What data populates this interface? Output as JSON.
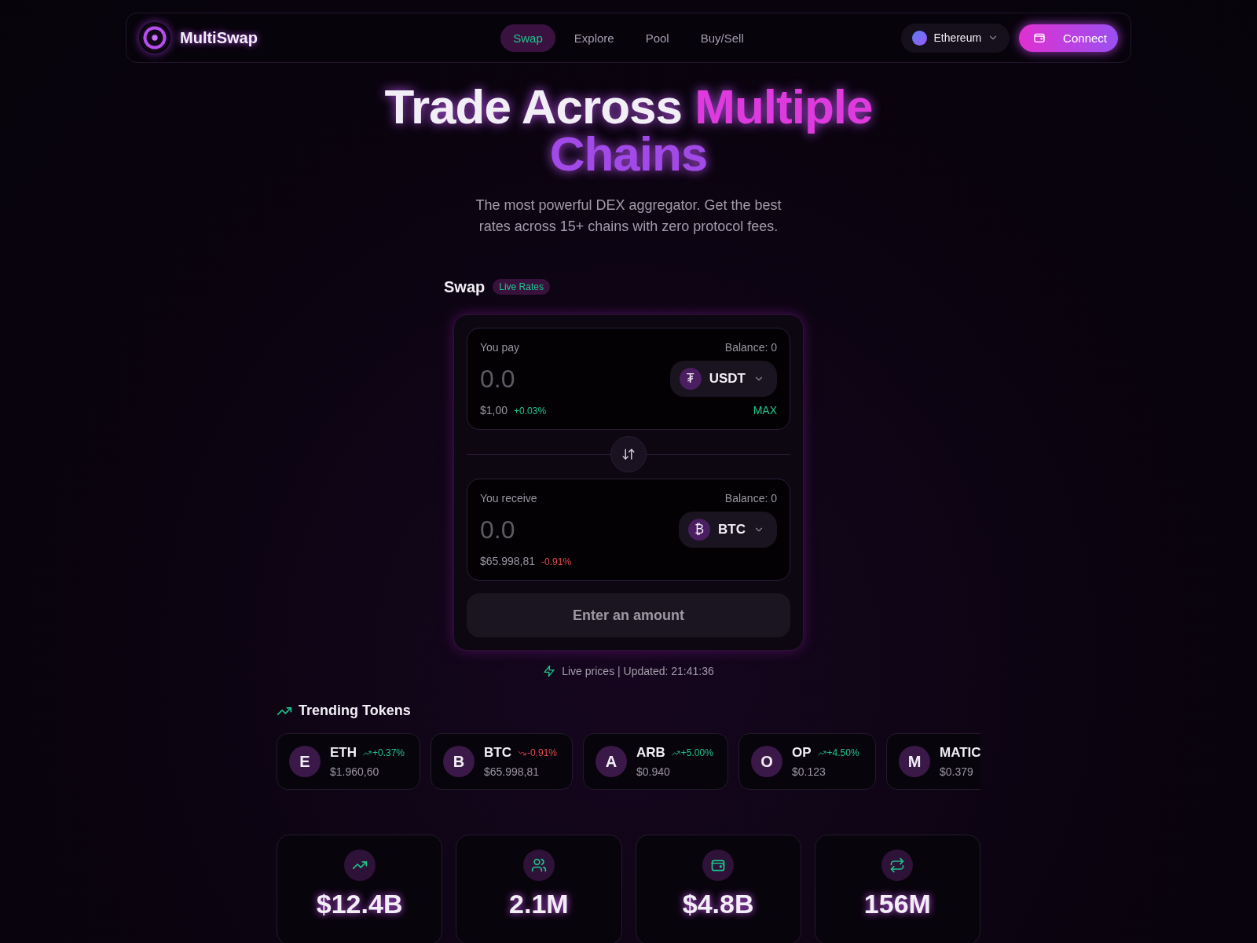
{
  "nav": {
    "brand": "MultiSwap",
    "links": [
      {
        "label": "Swap",
        "selected": true
      },
      {
        "label": "Explore",
        "selected": false
      },
      {
        "label": "Pool",
        "selected": false
      },
      {
        "label": "Buy/Sell",
        "selected": false
      }
    ],
    "network": "Ethereum",
    "connect": "Connect"
  },
  "hero": {
    "title_plain": "Trade Across ",
    "title_accent1": "Multiple",
    "title_accent2": "Chains",
    "subtitle": "The most powerful DEX aggregator. Get the best rates across 15+ chains with zero protocol fees."
  },
  "swap": {
    "title": "Swap",
    "badge": "Live Rates",
    "panels": [
      {
        "label": "You pay",
        "balance": "Balance: 0",
        "placeholder": "0.0",
        "token": "USDT",
        "token_glyph": "₮",
        "price": "$1,00",
        "change": "+0.03%",
        "kind": "up",
        "max": "MAX"
      },
      {
        "label": "You receive",
        "balance": "Balance: 0",
        "placeholder": "0.0",
        "token": "BTC",
        "token_glyph": "₿",
        "price": "$65.998,81",
        "change": "-0.91%",
        "kind": "down"
      }
    ],
    "action": "Enter an amount",
    "status": "Live prices | Updated: 21:41:36"
  },
  "trending": {
    "title": "Trending Tokens",
    "tokens": [
      {
        "letter": "E",
        "symbol": "ETH",
        "change": "+0.37%",
        "kind": "up",
        "price": "$1.960,60"
      },
      {
        "letter": "B",
        "symbol": "BTC",
        "change": "-0.91%",
        "kind": "down",
        "price": "$65.998,81"
      },
      {
        "letter": "A",
        "symbol": "ARB",
        "change": "+5.00%",
        "kind": "up",
        "price": "$0.940"
      },
      {
        "letter": "O",
        "symbol": "OP",
        "change": "+4.50%",
        "kind": "up",
        "price": "$0.123"
      },
      {
        "letter": "M",
        "symbol": "MATIC",
        "price": "$0.379"
      }
    ]
  },
  "stats": [
    {
      "kind": "trend",
      "value": "$12.4B"
    },
    {
      "kind": "users",
      "value": "2.1M"
    },
    {
      "kind": "wallet",
      "value": "$4.8B"
    },
    {
      "kind": "swap",
      "value": "156M"
    }
  ]
}
